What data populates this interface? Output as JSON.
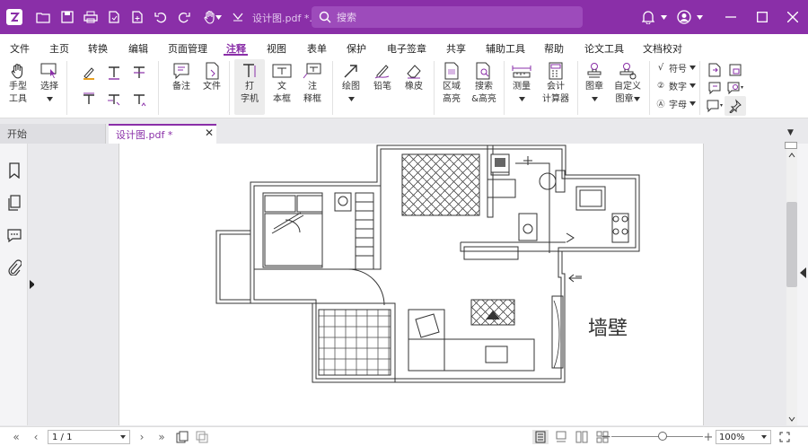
{
  "app": {
    "document_title": "设计图.pdf *...",
    "search_placeholder": "搜索"
  },
  "menu": [
    "文件",
    "主页",
    "转换",
    "编辑",
    "页面管理",
    "注释",
    "视图",
    "表单",
    "保护",
    "电子签章",
    "共享",
    "辅助工具",
    "帮助",
    "论文工具",
    "文档校对"
  ],
  "active_menu": "注释",
  "ribbon": {
    "hand_tool": [
      "手型",
      "工具"
    ],
    "select": "选择",
    "note": "备注",
    "file": "文件",
    "typewriter": [
      "打",
      "字机"
    ],
    "textbox": [
      "文",
      "本框"
    ],
    "callout": [
      "注",
      "释框"
    ],
    "drawing": "绘图",
    "pencil": "铅笔",
    "eraser": "橡皮",
    "area_highlight": [
      "区域",
      "高亮"
    ],
    "search_highlight": [
      "搜索",
      "&高亮"
    ],
    "measure": "测量",
    "accounting_calc": [
      "会计",
      "计算器"
    ],
    "stamp": "图章",
    "custom_stamp": [
      "自定义",
      "图章"
    ],
    "symbol": "符号",
    "number": "数字",
    "letter": "字母"
  },
  "tabs": {
    "start": "开始",
    "document": "设计图.pdf *"
  },
  "drawing_text": "墙壁",
  "status": {
    "page_indicator": "1 / 1",
    "zoom": "100%"
  },
  "colors": {
    "accent": "#8a2fa8",
    "title_bar": "#8a2fa8"
  }
}
